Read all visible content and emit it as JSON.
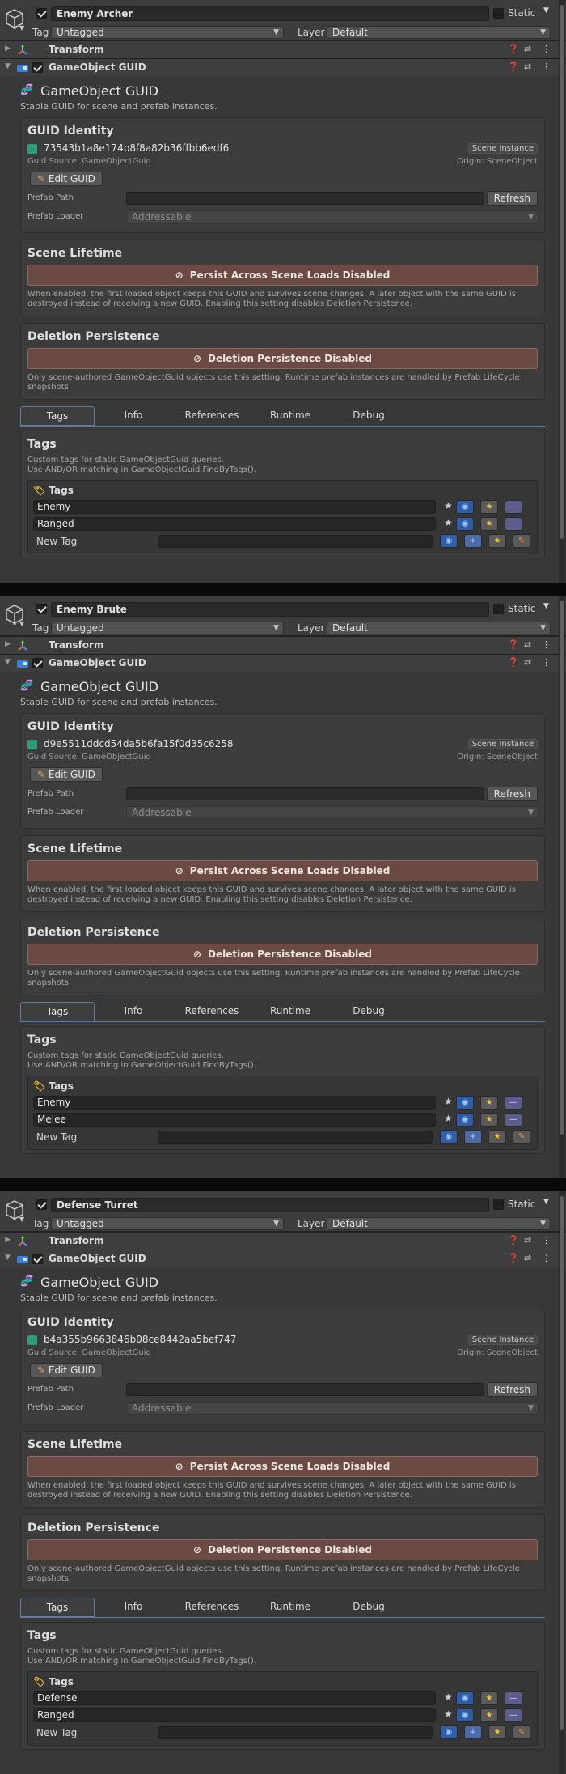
{
  "colors": {
    "warn_bar": "#6a4a43",
    "guid_check": "#2c9c7a",
    "tab_accent": "#5e7aa6"
  },
  "inspectors": [
    {
      "object_name": "Enemy Archer",
      "static_label": "Static",
      "tag_label": "Tag",
      "tag_value": "Untagged",
      "layer_label": "Layer",
      "layer_value": "Default",
      "transform_label": "Transform",
      "component_label": "GameObject GUID",
      "guid_title": "GameObject GUID",
      "guid_subtitle": "Stable GUID for scene and prefab instances.",
      "identity_header": "GUID Identity",
      "guid_value": "73543b1a8e174b8f8a82b36ffbb6edf6",
      "scene_badge": "Scene Instance",
      "guid_source": "Guid Source: GameObjectGuid",
      "origin": "Origin: SceneObject",
      "edit_guid": "Edit GUID",
      "prefab_path_label": "Prefab Path",
      "refresh": "Refresh",
      "prefab_loader_label": "Prefab Loader",
      "prefab_loader_value": "Addressable",
      "scene_lifetime_header": "Scene Lifetime",
      "persist_label": "Persist Across Scene Loads Disabled",
      "persist_desc": "When enabled, the first loaded object keeps this GUID and survives scene changes. A later object with the same GUID is destroyed instead of receiving a new GUID. Enabling this setting disables Deletion Persistence.",
      "deletion_header": "Deletion Persistence",
      "deletion_label": "Deletion Persistence Disabled",
      "deletion_desc": "Only scene-authored GameObjectGuid objects use this setting. Runtime prefab instances are handled by Prefab LifeCycle snapshots.",
      "tabs": [
        "Tags",
        "Info",
        "References",
        "Runtime",
        "Debug"
      ],
      "tags_header": "Tags",
      "tags_desc_1": "Custom tags for static GameObjectGuid queries.",
      "tags_desc_2": "Use AND/OR matching in GameObjectGuid.FindByTags().",
      "tags_sub": "Tags",
      "tags": [
        "Enemy",
        "Ranged"
      ],
      "new_tag_label": "New Tag"
    },
    {
      "object_name": "Enemy Brute",
      "static_label": "Static",
      "tag_label": "Tag",
      "tag_value": "Untagged",
      "layer_label": "Layer",
      "layer_value": "Default",
      "transform_label": "Transform",
      "component_label": "GameObject GUID",
      "guid_title": "GameObject GUID",
      "guid_subtitle": "Stable GUID for scene and prefab instances.",
      "identity_header": "GUID Identity",
      "guid_value": "d9e5511ddcd54da5b6fa15f0d35c6258",
      "scene_badge": "Scene Instance",
      "guid_source": "Guid Source: GameObjectGuid",
      "origin": "Origin: SceneObject",
      "edit_guid": "Edit GUID",
      "prefab_path_label": "Prefab Path",
      "refresh": "Refresh",
      "prefab_loader_label": "Prefab Loader",
      "prefab_loader_value": "Addressable",
      "scene_lifetime_header": "Scene Lifetime",
      "persist_label": "Persist Across Scene Loads Disabled",
      "persist_desc": "When enabled, the first loaded object keeps this GUID and survives scene changes. A later object with the same GUID is destroyed instead of receiving a new GUID. Enabling this setting disables Deletion Persistence.",
      "deletion_header": "Deletion Persistence",
      "deletion_label": "Deletion Persistence Disabled",
      "deletion_desc": "Only scene-authored GameObjectGuid objects use this setting. Runtime prefab instances are handled by Prefab LifeCycle snapshots.",
      "tabs": [
        "Tags",
        "Info",
        "References",
        "Runtime",
        "Debug"
      ],
      "tags_header": "Tags",
      "tags_desc_1": "Custom tags for static GameObjectGuid queries.",
      "tags_desc_2": "Use AND/OR matching in GameObjectGuid.FindByTags().",
      "tags_sub": "Tags",
      "tags": [
        "Enemy",
        "Melee"
      ],
      "new_tag_label": "New Tag"
    },
    {
      "object_name": "Defense Turret",
      "static_label": "Static",
      "tag_label": "Tag",
      "tag_value": "Untagged",
      "layer_label": "Layer",
      "layer_value": "Default",
      "transform_label": "Transform",
      "component_label": "GameObject GUID",
      "guid_title": "GameObject GUID",
      "guid_subtitle": "Stable GUID for scene and prefab instances.",
      "identity_header": "GUID Identity",
      "guid_value": "b4a355b9663846b08ce8442aa5bef747",
      "scene_badge": "Scene Instance",
      "guid_source": "Guid Source: GameObjectGuid",
      "origin": "Origin: SceneObject",
      "edit_guid": "Edit GUID",
      "prefab_path_label": "Prefab Path",
      "refresh": "Refresh",
      "prefab_loader_label": "Prefab Loader",
      "prefab_loader_value": "Addressable",
      "scene_lifetime_header": "Scene Lifetime",
      "persist_label": "Persist Across Scene Loads Disabled",
      "persist_desc": "When enabled, the first loaded object keeps this GUID and survives scene changes. A later object with the same GUID is destroyed instead of receiving a new GUID. Enabling this setting disables Deletion Persistence.",
      "deletion_header": "Deletion Persistence",
      "deletion_label": "Deletion Persistence Disabled",
      "deletion_desc": "Only scene-authored GameObjectGuid objects use this setting. Runtime prefab instances are handled by Prefab LifeCycle snapshots.",
      "tabs": [
        "Tags",
        "Info",
        "References",
        "Runtime",
        "Debug"
      ],
      "tags_header": "Tags",
      "tags_desc_1": "Custom tags for static GameObjectGuid queries.",
      "tags_desc_2": "Use AND/OR matching in GameObjectGuid.FindByTags().",
      "tags_sub": "Tags",
      "tags": [
        "Defense",
        "Ranged"
      ],
      "new_tag_label": "New Tag"
    }
  ]
}
